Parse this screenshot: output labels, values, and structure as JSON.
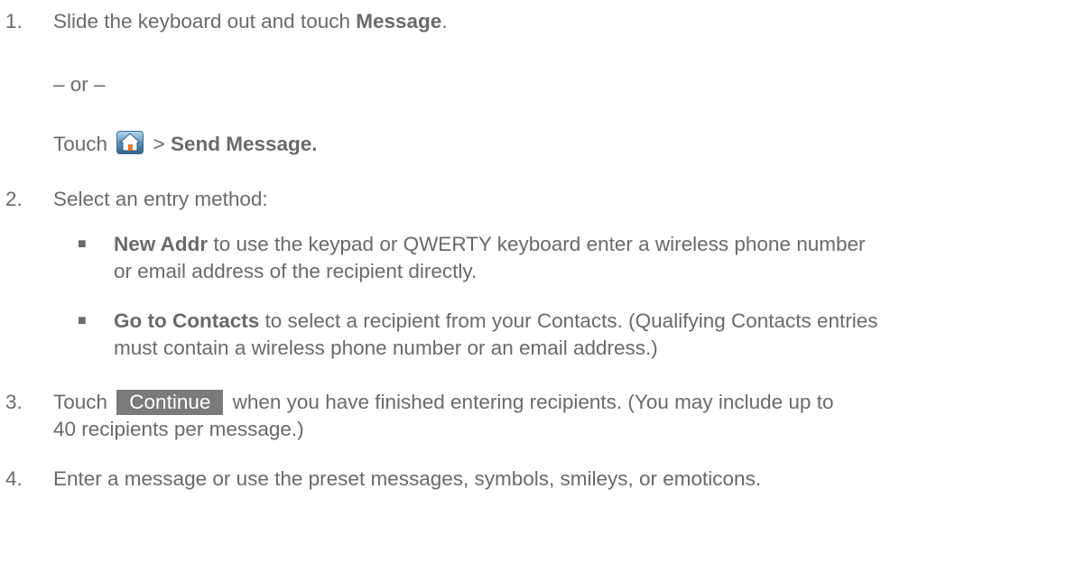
{
  "steps": {
    "s1": {
      "num": "1.",
      "pre": "Slide the keyboard out and touch ",
      "bold": "Message",
      "post": "."
    },
    "or": "– or –",
    "touch": {
      "pre": "Touch ",
      "sep": " > ",
      "bold": "Send Message."
    },
    "s2": {
      "num": "2.",
      "text": "Select an entry method:"
    },
    "b1": {
      "bold": "New Addr",
      "line1": " to use the keypad or QWERTY keyboard enter a wireless phone number",
      "line2": "or email address of the recipient directly."
    },
    "b2": {
      "bold": "Go to Contacts",
      "line1": " to select a recipient from your Contacts. (Qualifying Contacts entries",
      "line2": "must contain a wireless phone number or an email address.)"
    },
    "s3": {
      "num": "3.",
      "pre": "Touch ",
      "button": "Continue",
      "line1": " when you have finished entering recipients. (You may include up to",
      "line2": "40 recipients per message.)"
    },
    "s4": {
      "num": "4.",
      "text": "Enter a message or use the preset messages, symbols, smileys, or emoticons."
    }
  },
  "icons": {
    "home": "home-icon",
    "bullet": "square-bullet"
  },
  "colors": {
    "text": "#6a6a6a",
    "button_bg": "#7b7b7b",
    "button_text": "#ffffff"
  }
}
